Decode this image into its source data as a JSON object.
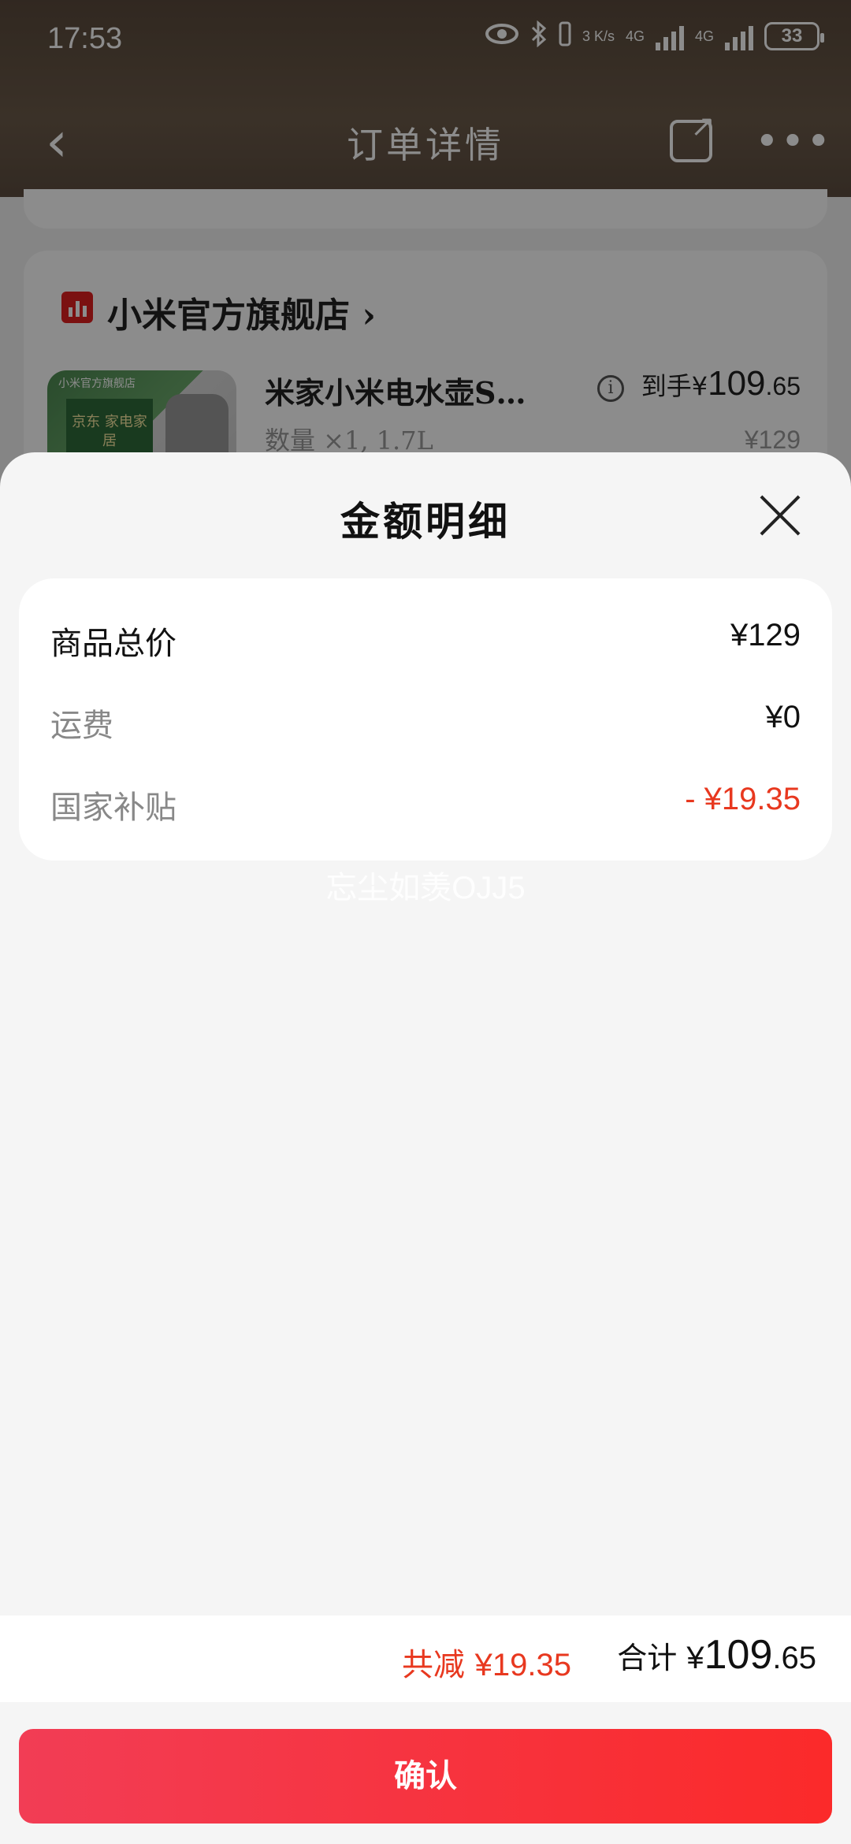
{
  "status_bar": {
    "time": "17:53",
    "net_speed": "3 K/s",
    "network_1": "4G",
    "network_2": "4G",
    "battery": "33"
  },
  "nav": {
    "back_glyph": "‹",
    "title": "订单详情",
    "more_glyph": "•••"
  },
  "store": {
    "name": "小米官方旗舰店 ›"
  },
  "product": {
    "title": "米家小米电水壶S…",
    "final_prefix": "到手¥",
    "final_int": "109",
    "final_dec": ".65",
    "qty": "数量 ×1, 1.7L",
    "original_price": "¥129",
    "thumb_tag": "小米官方旗舰店",
    "thumb_sign": "京东 家电家居"
  },
  "sheet": {
    "title": "金额明细",
    "rows": [
      {
        "label": "商品总价",
        "value": "¥129"
      },
      {
        "label": "运费",
        "value": "¥0"
      },
      {
        "label": "国家补贴",
        "value": "- ¥19.35"
      }
    ],
    "watermark": "忘尘如羡OJJ5"
  },
  "totals": {
    "save_label": "共减",
    "save_value": "¥19.35",
    "sum_label": "合计",
    "sum_yen": "¥",
    "sum_int": "109",
    "sum_dec": ".65"
  },
  "confirm_label": "确认",
  "colors": {
    "accent_red": "#e8381f",
    "button_start": "#f23d55",
    "button_end": "#fb2a2a"
  }
}
